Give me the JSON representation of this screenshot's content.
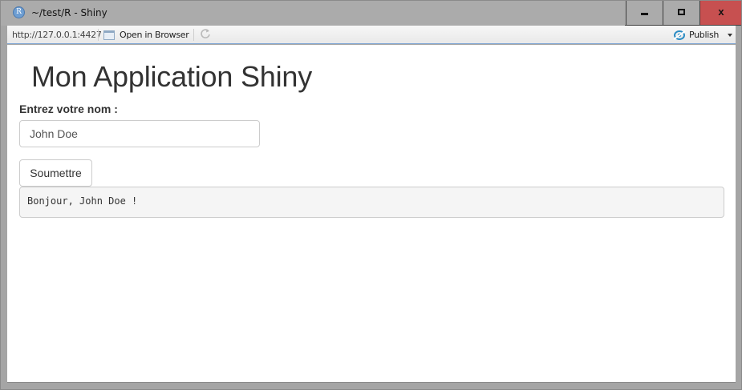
{
  "window": {
    "title": "~/test/R - Shiny",
    "app_icon_letter": "R",
    "controls": {
      "minimize": "minimize-icon",
      "maximize": "maximize-icon",
      "close": "x"
    }
  },
  "toolbar": {
    "url": "http://127.0.0.1:4427",
    "open_in_browser_label": "Open in Browser",
    "publish_label": "Publish",
    "colors": {
      "publish_icon": "#2b8cc4",
      "toolbar_border": "#7fa6d4",
      "close_button": "#c75050"
    }
  },
  "app": {
    "title": "Mon Application Shiny",
    "name_label": "Entrez votre nom :",
    "name_value": "John Doe",
    "submit_label": "Soumettre",
    "output_text": "Bonjour, John Doe !"
  }
}
